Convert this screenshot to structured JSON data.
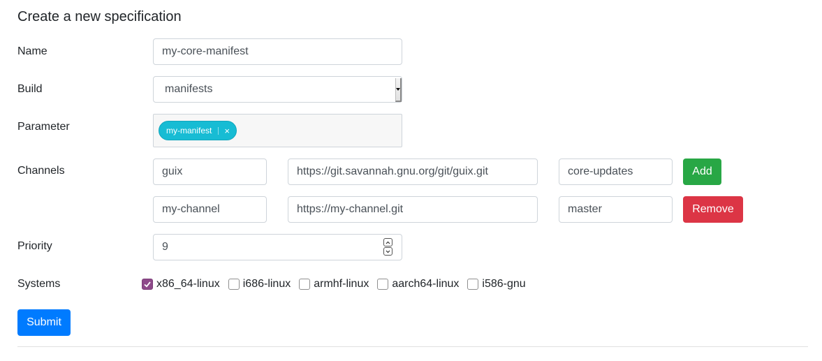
{
  "page": {
    "title": "Create a new specification"
  },
  "form": {
    "name": {
      "label": "Name",
      "value": "my-core-manifest"
    },
    "build": {
      "label": "Build",
      "selected": "manifests"
    },
    "parameter": {
      "label": "Parameter",
      "tags": [
        {
          "text": "my-manifest",
          "remove": "×"
        }
      ]
    },
    "channels": {
      "label": "Channels",
      "rows": [
        {
          "name": "guix",
          "url": "https://git.savannah.gnu.org/git/guix.git",
          "branch": "core-updates",
          "action": "Add"
        },
        {
          "name": "my-channel",
          "url": "https://my-channel.git",
          "branch": "master",
          "action": "Remove"
        }
      ]
    },
    "priority": {
      "label": "Priority",
      "value": "9",
      "up": "^",
      "down": "v"
    },
    "systems": {
      "label": "Systems",
      "options": [
        {
          "label": "x86_64-linux",
          "checked": true
        },
        {
          "label": "i686-linux",
          "checked": false
        },
        {
          "label": "armhf-linux",
          "checked": false
        },
        {
          "label": "aarch64-linux",
          "checked": false
        },
        {
          "label": "i586-gnu",
          "checked": false
        }
      ]
    },
    "submit_label": "Submit"
  },
  "colors": {
    "primary": "#007bff",
    "success": "#28a745",
    "danger": "#dc3545",
    "tag": "#17bcd4",
    "checkbox_checked": "#8e4a8a"
  }
}
